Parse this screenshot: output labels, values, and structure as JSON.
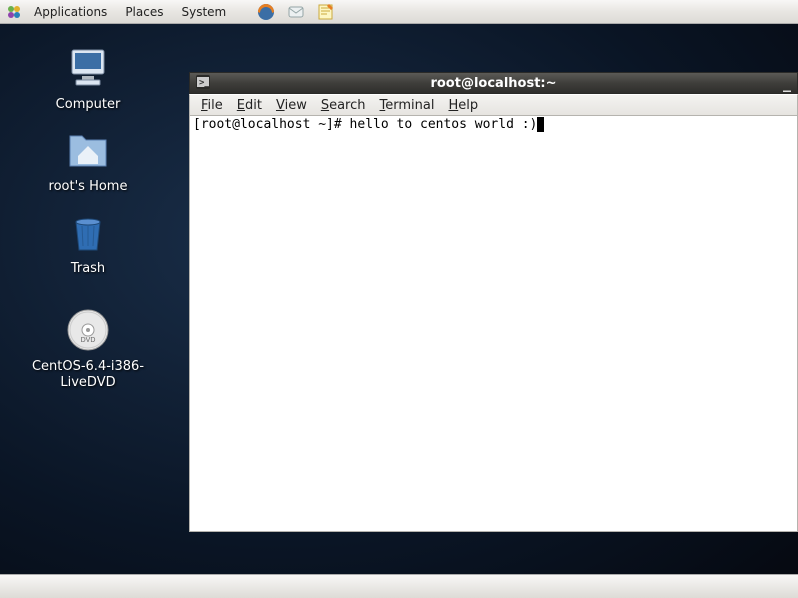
{
  "panel": {
    "menus": [
      "Applications",
      "Places",
      "System"
    ]
  },
  "desktop": {
    "icons": [
      {
        "label": "Computer"
      },
      {
        "label": "root's Home"
      },
      {
        "label": "Trash"
      },
      {
        "label": "CentOS-6.4-i386-LiveDVD"
      }
    ]
  },
  "window": {
    "title": "root@localhost:~",
    "menus": {
      "file": "File",
      "edit": "Edit",
      "view": "View",
      "search": "Search",
      "terminal": "Terminal",
      "help": "Help"
    },
    "terminal": {
      "prompt": "[root@localhost ~]# ",
      "input": "hello to centos world :)"
    }
  }
}
